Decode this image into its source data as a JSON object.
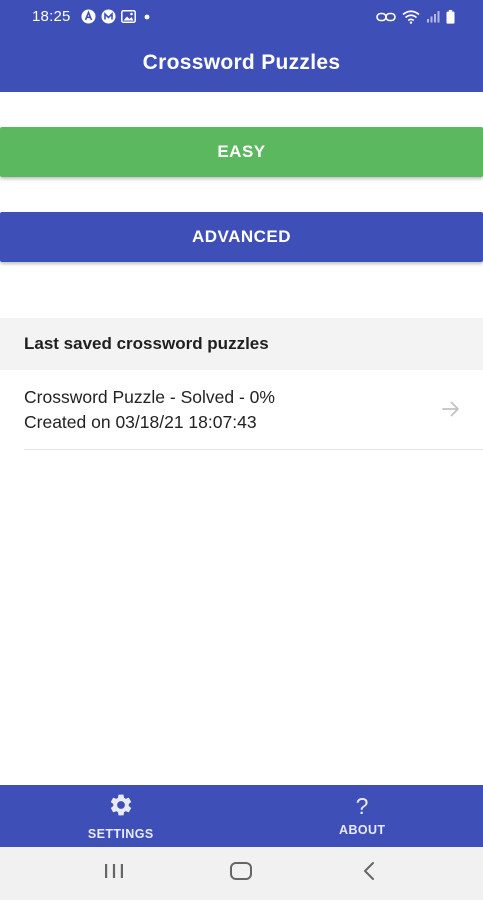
{
  "status_bar": {
    "time": "18:25",
    "notification_icons": [
      "a-circle-icon",
      "m-circle-icon",
      "image-icon",
      "dot-icon"
    ],
    "system_icons": [
      "link-icon",
      "wifi-icon",
      "signal-icon",
      "battery-icon"
    ]
  },
  "app_bar": {
    "title": "Crossword Puzzles"
  },
  "buttons": {
    "easy_label": "EASY",
    "advanced_label": "ADVANCED"
  },
  "colors": {
    "primary": "#3f4fb8",
    "easy_green": "#5cb85f"
  },
  "saved": {
    "header": "Last saved crossword puzzles",
    "items": [
      {
        "title": "Crossword Puzzle - Solved - 0%",
        "created": "Created on 03/18/21 18:07:43",
        "icon": "arrow-right-icon"
      }
    ]
  },
  "bottom_nav": {
    "settings_label": "SETTINGS",
    "settings_icon": "gear-icon",
    "about_label": "ABOUT",
    "about_glyph": "?"
  },
  "system_nav": {
    "icons": [
      "recents-icon",
      "home-icon",
      "back-icon"
    ]
  }
}
